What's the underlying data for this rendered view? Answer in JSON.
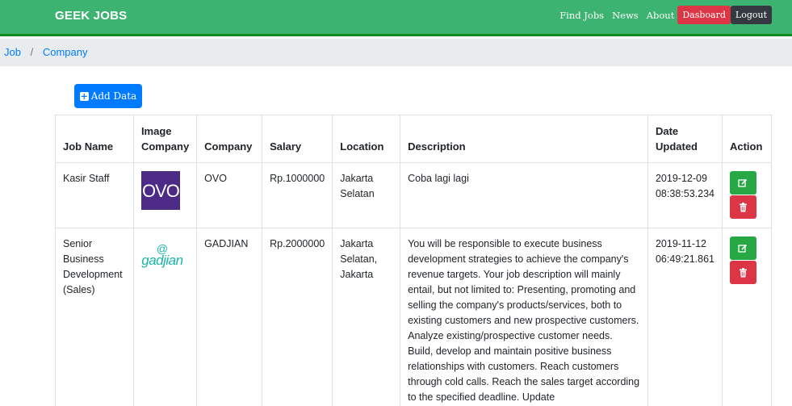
{
  "navbar": {
    "brand": "GEEK JOBS",
    "links": [
      "Find Jobs",
      "News",
      "About"
    ],
    "dashboard_label": "Dasboard",
    "logout_label": "Logout"
  },
  "breadcrumb": {
    "items": [
      "Job",
      "Company"
    ]
  },
  "add_button": {
    "label": "Add Data"
  },
  "table": {
    "headers": [
      "Job Name",
      "Image Company",
      "Company",
      "Salary",
      "Location",
      "Description",
      "Date Updated",
      "Action"
    ],
    "rows": [
      {
        "job_name": "Kasir Staff",
        "logo_text": "OVO",
        "company": "OVO",
        "salary": "Rp.1000000",
        "location": "Jakarta Selatan",
        "description": "Coba lagi lagi",
        "date_updated": "2019-12-09 08:38:53.234"
      },
      {
        "job_name": "Senior Business Development (Sales)",
        "logo_text": "gadjian",
        "company": "GADJIAN",
        "salary": "Rp.2000000",
        "location": "Jakarta Selatan, Jakarta",
        "description": "You will be responsible to execute business development strategies to achieve the company's revenue targets. Your job description will mainly entail, but not limited to: Presenting, promoting and selling the company's products/services, both to existing customers and new prospective customers. Analyze existing/prospective customer needs. Build, develop and maintain positive business relationships with customers. Reach customers through cold calls. Reach the sales target according to the specified deadline. Update",
        "date_updated": "2019-11-12 06:49:21.861"
      }
    ]
  },
  "icons": {
    "add": "plus-square-icon",
    "edit": "edit-icon",
    "delete": "trash-icon"
  },
  "colors": {
    "navbar": "#3cb371",
    "primary": "#007bff",
    "success": "#28a745",
    "danger": "#dc3545",
    "dark": "#343a40"
  }
}
